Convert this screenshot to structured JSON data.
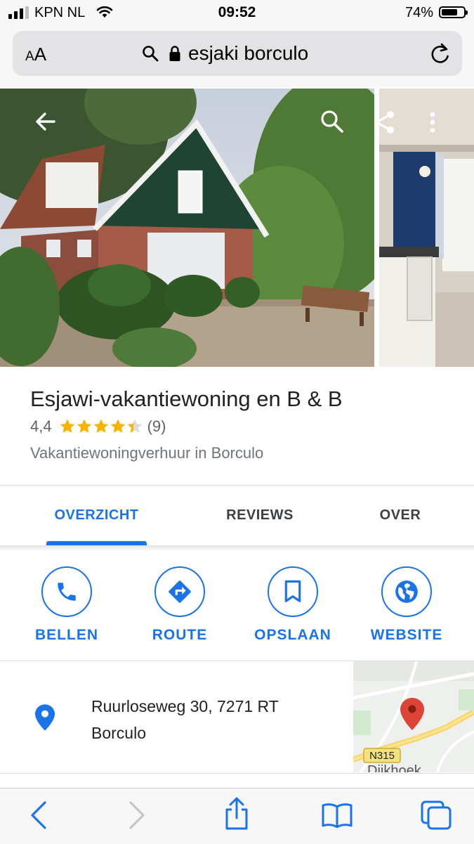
{
  "status_bar": {
    "carrier": "KPN NL",
    "time": "09:52",
    "battery": "74%",
    "battery_level": 0.74,
    "signal_bars": 3,
    "signal_icon": "signal-icon",
    "wifi_icon": "wifi-icon"
  },
  "browser": {
    "text_size_label": "AA",
    "url_text": "esjaki borculo",
    "icons": [
      "search-icon",
      "lock-icon",
      "reload-icon"
    ]
  },
  "photo_overlay": {
    "icons": [
      "back-arrow-icon",
      "search-icon",
      "share-icon",
      "more-vert-icon"
    ]
  },
  "place": {
    "title": "Esjawi-vakantiewoning en B & B",
    "rating": "4,4",
    "rating_value": 4.4,
    "review_count": "(9)",
    "category": "Vakantiewoningverhuur in Borculo"
  },
  "tabs": [
    {
      "label": "OVERZICHT",
      "active": true
    },
    {
      "label": "REVIEWS",
      "active": false
    },
    {
      "label": "OVER",
      "active": false
    }
  ],
  "actions": [
    {
      "label": "BELLEN",
      "icon": "phone-icon"
    },
    {
      "label": "ROUTE",
      "icon": "directions-icon"
    },
    {
      "label": "OPSLAAN",
      "icon": "bookmark-icon"
    },
    {
      "label": "WEBSITE",
      "icon": "globe-icon"
    }
  ],
  "address": {
    "line1": "Ruurloseweg 30, 7271 RT",
    "line2": "Borculo",
    "icon": "location-pin-icon"
  },
  "map": {
    "road_label": "N315",
    "place_label": "Dijkhoek"
  },
  "toolbar": {
    "icons": [
      "back-icon",
      "forward-icon",
      "share-icon",
      "bookmarks-icon",
      "tabs-icon"
    ]
  },
  "colors": {
    "accent": "#1a73e8",
    "star": "#f4b400",
    "map_pin": "#db4437"
  }
}
